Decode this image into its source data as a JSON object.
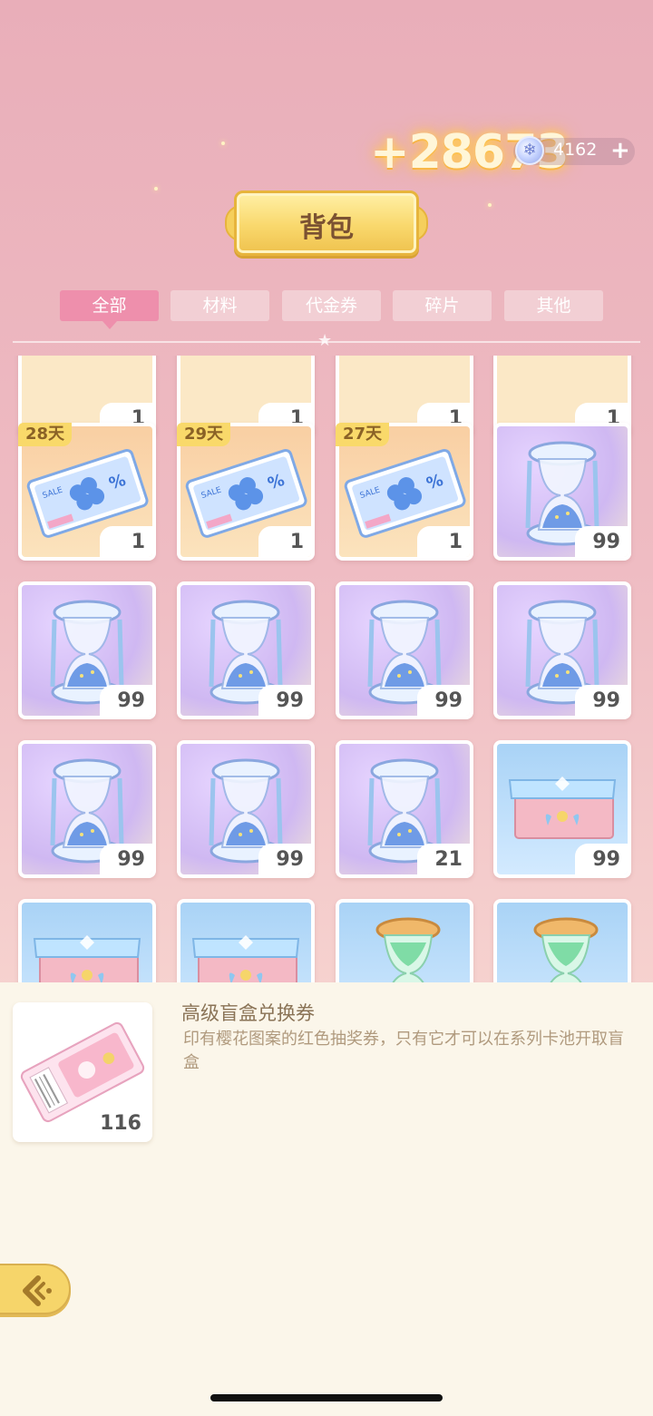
{
  "currency": {
    "gain": "+28673",
    "gem_amount": "4162",
    "gem_icon": "snowflake-gem-icon",
    "plus_label": "+"
  },
  "title": "背包",
  "tabs": [
    {
      "label": "全部",
      "active": true
    },
    {
      "label": "材料",
      "active": false
    },
    {
      "label": "代金券",
      "active": false
    },
    {
      "label": "碎片",
      "active": false
    },
    {
      "label": "其他",
      "active": false
    }
  ],
  "grid": {
    "rows": [
      [
        {
          "icon": "green-plush-icon",
          "bg": "cream",
          "qty": "1",
          "days": ""
        },
        {
          "icon": "plate-icon",
          "bg": "cream",
          "qty": "1",
          "days": ""
        },
        {
          "icon": "grey-item-icon",
          "bg": "cream",
          "qty": "1",
          "days": ""
        },
        {
          "icon": "golden-item-icon",
          "bg": "cream",
          "qty": "1",
          "days": ""
        }
      ],
      [
        {
          "icon": "sale-coupon-icon",
          "bg": "orange",
          "qty": "1",
          "days": "28天"
        },
        {
          "icon": "sale-coupon-icon",
          "bg": "orange",
          "qty": "1",
          "days": "29天"
        },
        {
          "icon": "sale-coupon-icon",
          "bg": "orange",
          "qty": "1",
          "days": "27天"
        },
        {
          "icon": "hourglass-blue-icon",
          "bg": "purple",
          "qty": "99",
          "days": ""
        }
      ],
      [
        {
          "icon": "hourglass-blue-icon",
          "bg": "purple",
          "qty": "99",
          "days": ""
        },
        {
          "icon": "hourglass-blue-icon",
          "bg": "purple",
          "qty": "99",
          "days": ""
        },
        {
          "icon": "hourglass-blue-icon",
          "bg": "purple",
          "qty": "99",
          "days": ""
        },
        {
          "icon": "hourglass-blue-icon",
          "bg": "purple",
          "qty": "99",
          "days": ""
        }
      ],
      [
        {
          "icon": "hourglass-blue-icon",
          "bg": "purple",
          "qty": "99",
          "days": ""
        },
        {
          "icon": "hourglass-blue-icon",
          "bg": "purple",
          "qty": "99",
          "days": ""
        },
        {
          "icon": "hourglass-blue-icon",
          "bg": "purple",
          "qty": "21",
          "days": ""
        },
        {
          "icon": "gift-box-icon",
          "bg": "blue",
          "qty": "99",
          "days": ""
        }
      ],
      [
        {
          "icon": "gift-box-icon",
          "bg": "blue",
          "qty": "",
          "days": ""
        },
        {
          "icon": "gift-box-icon",
          "bg": "blue",
          "qty": "",
          "days": ""
        },
        {
          "icon": "hourglass-green-icon",
          "bg": "blue",
          "qty": "",
          "days": ""
        },
        {
          "icon": "hourglass-green-icon",
          "bg": "blue",
          "qty": "",
          "days": ""
        }
      ]
    ]
  },
  "detail": {
    "name": "高级盲盒兑换券",
    "description": "印有樱花图案的红色抽奖券，只有它才可以在系列卡池开取盲盒",
    "qty": "116",
    "icon": "blind-box-ticket-icon"
  },
  "nav": {
    "back_icon": "back-arrow-icon"
  },
  "colors": {
    "tab_active": "#ee8fac",
    "plaque": "#f9d86c",
    "days_badge": "#f9d96a"
  }
}
